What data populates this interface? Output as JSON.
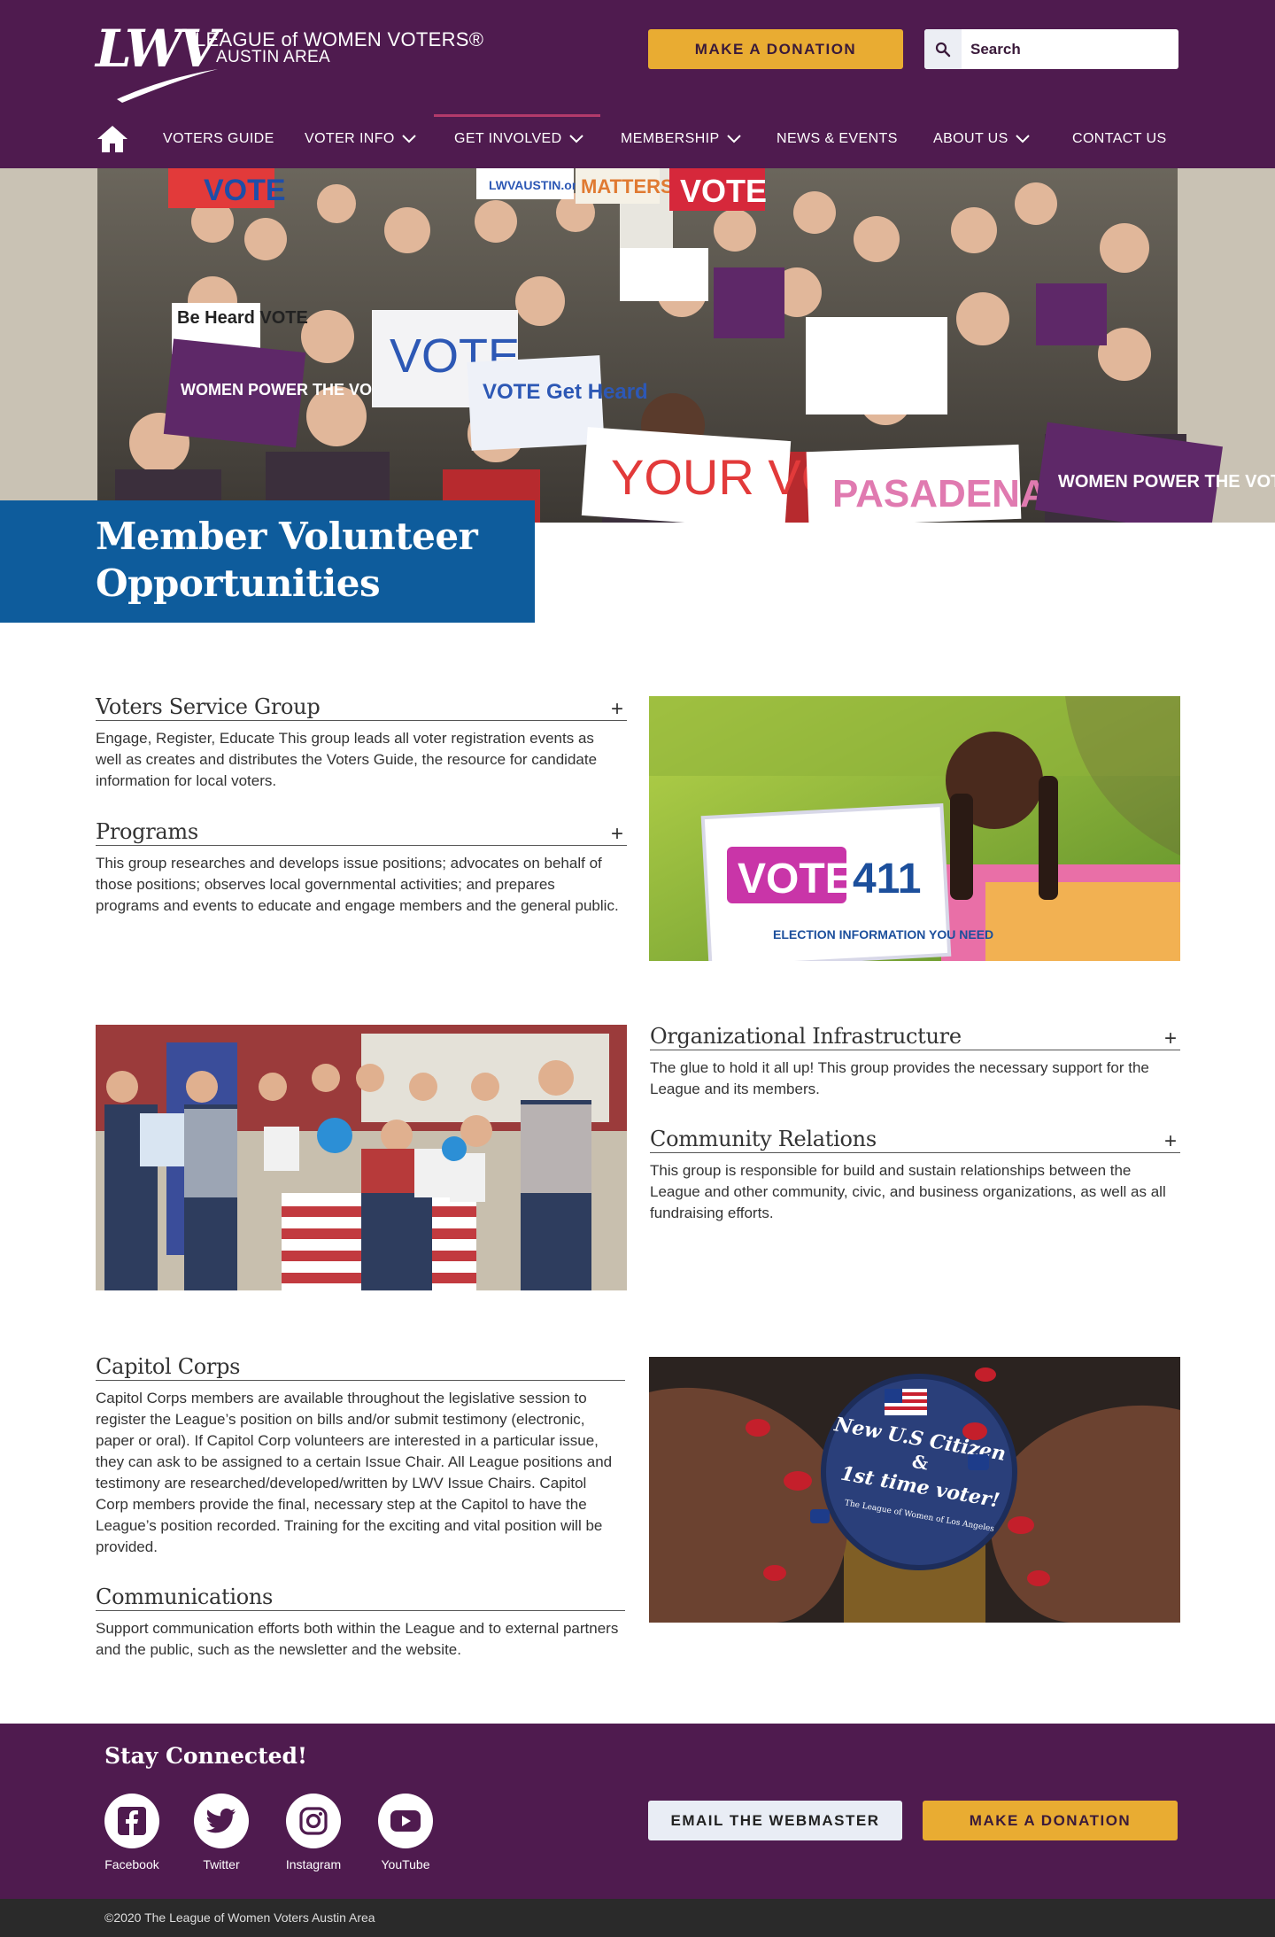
{
  "header": {
    "logo_mark": "LWV",
    "logo_line1": "LEAGUE of WOMEN VOTERS®",
    "logo_line2": "AUSTIN AREA",
    "donate_label": "MAKE A DONATION",
    "search_placeholder": "Search"
  },
  "nav": {
    "items": [
      {
        "label": "VOTERS GUIDE"
      },
      {
        "label": "VOTER INFO"
      },
      {
        "label": "GET INVOLVED"
      },
      {
        "label": "MEMBERSHIP"
      },
      {
        "label": "NEWS & EVENTS"
      },
      {
        "label": "ABOUT US"
      },
      {
        "label": "CONTACT US"
      }
    ]
  },
  "hero": {
    "title": "Member Volunteer Opportunities",
    "signs": [
      "VOTE",
      "Be Heard VOTE",
      "WOMEN POWER THE VOTE",
      "VOTE",
      "VOTE Get Heard",
      "YOUR VOTE",
      "PASADENA",
      "WOMEN POWER THE VOTE",
      "LWVAUSTIN.org",
      "MATTERS",
      "VOTE"
    ]
  },
  "sections": {
    "voters_service": {
      "title": "Voters Service Group",
      "body": "Engage, Register, Educate This group leads all voter registration events as well as creates and distributes the Voters Guide, the resource for candidate information for local voters."
    },
    "programs": {
      "title": "Programs",
      "body": "This group researches and develops issue positions; advocates on behalf of those positions; observes local governmental activities; and prepares programs and events to educate and engage members and the general public."
    },
    "org_infra": {
      "title": "Organizational Infrastructure",
      "body": "The glue to hold it all up! This group provides the necessary support for the League and its members."
    },
    "community": {
      "title": "Community Relations",
      "body": "This group is responsible for build and sustain relationships between the League and other community, civic, and business organizations, as well as all fundraising efforts."
    },
    "capitol": {
      "title": "Capitol Corps",
      "body": "Capitol Corps members are available throughout the legislative session to register the League’s position on bills and/or submit testimony (electronic, paper or oral). If Capitol Corp volunteers are interested in a particular issue, they can ask to be assigned to a certain Issue Chair. All League positions and testimony are researched/developed/written by LWV Issue Chairs. Capitol Corp members provide the final, necessary step at the Capitol to have the League’s position recorded. Training for the exciting and vital position will be provided."
    },
    "communications": {
      "title": "Communications",
      "body": "Support communication efforts both within the League and to external partners and the public, such as the newsletter and the website."
    }
  },
  "photos": {
    "vote411": {
      "big": "VOTE",
      "num": "411",
      "sub": "ELECTION INFORMATION YOU NEED"
    },
    "button": {
      "line1": "New U.S Citizen",
      "line2": "&",
      "line3": "1st time voter!",
      "line4": "The League of Women of Los Angeles"
    }
  },
  "footer": {
    "title": "Stay Connected!",
    "social": [
      {
        "label": "Facebook",
        "icon": "facebook-icon"
      },
      {
        "label": "Twitter",
        "icon": "twitter-icon"
      },
      {
        "label": "Instagram",
        "icon": "instagram-icon"
      },
      {
        "label": "YouTube",
        "icon": "youtube-icon"
      }
    ],
    "email_label": "EMAIL THE WEBMASTER",
    "donate_label": "MAKE A DONATION",
    "copyright": "©2020 The League of Women Voters Austin Area"
  },
  "colors": {
    "brand_purple": "#4f1b4f",
    "accent_gold": "#e9ac32",
    "title_blue": "#0e5c9c"
  }
}
